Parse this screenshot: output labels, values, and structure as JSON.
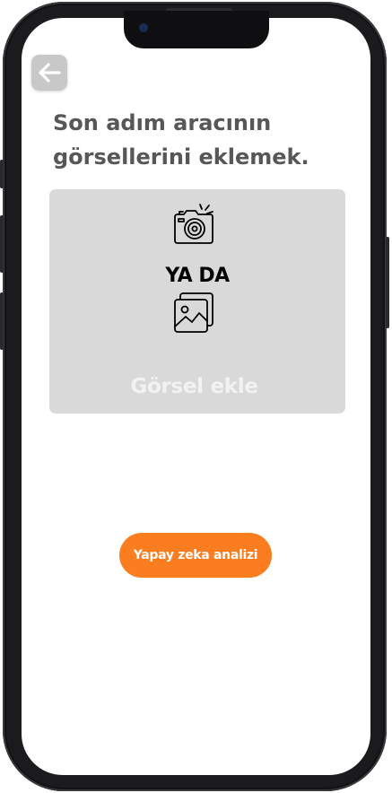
{
  "header": {
    "back_icon": "arrow-left-icon"
  },
  "title": {
    "line1": "Son adım aracının",
    "line2": "görsellerini eklemek."
  },
  "upload": {
    "camera_icon": "camera-icon",
    "or_text": "YA DA",
    "gallery_icon": "gallery-icon",
    "add_label": "Görsel ekle"
  },
  "actions": {
    "ai_analysis_label": "Yapay zeka analizi"
  },
  "colors": {
    "accent": "#fa7d20",
    "card_bg": "#d9d9d9",
    "title_text": "#575757",
    "back_button_bg": "#c8c8c8"
  }
}
